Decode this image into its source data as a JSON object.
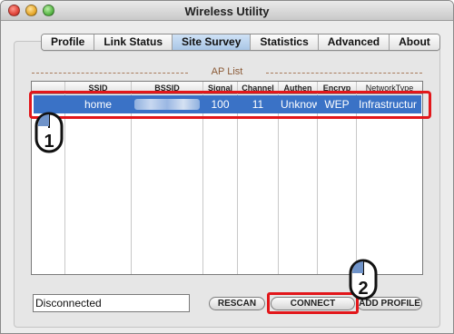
{
  "window": {
    "title": "Wireless Utility"
  },
  "tabs": [
    "Profile",
    "Link Status",
    "Site Survey",
    "Statistics",
    "Advanced",
    "About"
  ],
  "active_tab": "Site Survey",
  "ap_list": {
    "title": "AP List",
    "columns": [
      "SSID",
      "BSSID",
      "Signal",
      "Channel",
      "Authen",
      "Encryp",
      "NetworkType"
    ],
    "rows": [
      {
        "ssid": "home",
        "bssid": "",
        "signal": "100",
        "channel": "11",
        "authen": "Unknow",
        "encryp": "WEP",
        "network_type": "Infrastructur"
      }
    ]
  },
  "status": {
    "value": "Disconnected"
  },
  "buttons": {
    "rescan": "RESCAN",
    "connect": "CONNECT",
    "add_profile": "ADD PROFILE"
  },
  "callouts": {
    "step1": "1",
    "step2": "2"
  },
  "colors": {
    "selection": "#3a72c6",
    "highlight": "#e2171b",
    "ap_title": "#8b5a36",
    "active_tab": "#a9c6e6"
  }
}
